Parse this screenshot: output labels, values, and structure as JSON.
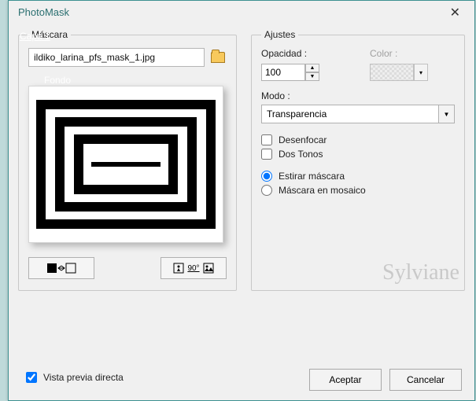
{
  "window": {
    "title": "PhotoMask",
    "close": "✕"
  },
  "hidden_layer_label": "Capa 1",
  "mask": {
    "legend": "Máscara",
    "filename": "ildiko_larina_pfs_mask_1.jpg",
    "hidden_bg_label": "Fondo",
    "flip_btn_icon": "flip",
    "rotate_btn_label": "90°"
  },
  "adjust": {
    "legend": "Ajustes",
    "opacity_label": "Opacidad :",
    "opacity_value": "100",
    "color_label": "Color :",
    "mode_label": "Modo :",
    "mode_value": "Transparencia",
    "blur_label": "Desenfocar",
    "blur_checked": false,
    "twotone_label": "Dos Tonos",
    "twotone_checked": false,
    "stretch_label": "Estirar máscara",
    "mosaic_label": "Máscara en mosaico",
    "radio_selected": "stretch"
  },
  "footer": {
    "preview_label": "Vista previa directa",
    "preview_checked": true,
    "ok": "Aceptar",
    "cancel": "Cancelar"
  },
  "signature": "Sylviane"
}
